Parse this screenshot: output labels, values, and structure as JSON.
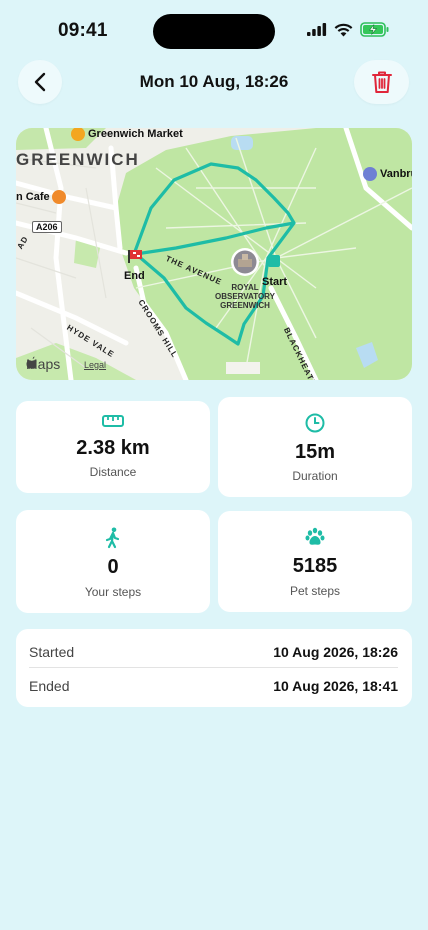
{
  "status": {
    "time": "09:41"
  },
  "header": {
    "title": "Mon 10 Aug, 18:26"
  },
  "map": {
    "labels": {
      "greenwich_market": "Greenwich Market",
      "district": "GREENWICH",
      "cafe": "n Cafe",
      "road_sign": "A206",
      "vanbrugh": "Vanbru",
      "end": "End",
      "start": "Start",
      "the_avenue": "THE AVENUE",
      "observatory": "ROYAL\nOBSERVATORY\nGREENWICH",
      "crooms_hill": "CROOMS HILL",
      "hyde_vale": "HYDE VALE",
      "blackheath": "BLACKHEATH",
      "ad": "AD",
      "apple_maps": "Maps",
      "legal": "Legal"
    },
    "colors": {
      "route": "#1ebca6",
      "park": "#bfe6a3",
      "water": "#b8dcf2"
    }
  },
  "stats": {
    "distance": {
      "value": "2.38 km",
      "label": "Distance",
      "icon": "ruler-icon"
    },
    "duration": {
      "value": "15m",
      "label": "Duration",
      "icon": "clock-icon"
    },
    "your_steps": {
      "value": "0",
      "label": "Your steps",
      "icon": "walking-person-icon"
    },
    "pet_steps": {
      "value": "5185",
      "label": "Pet steps",
      "icon": "paw-icon"
    }
  },
  "times": {
    "started_label": "Started",
    "started_value": "10 Aug 2026, 18:26",
    "ended_label": "Ended",
    "ended_value": "10 Aug 2026, 18:41"
  },
  "accent": "#1ebca6",
  "danger": "#e0263a"
}
